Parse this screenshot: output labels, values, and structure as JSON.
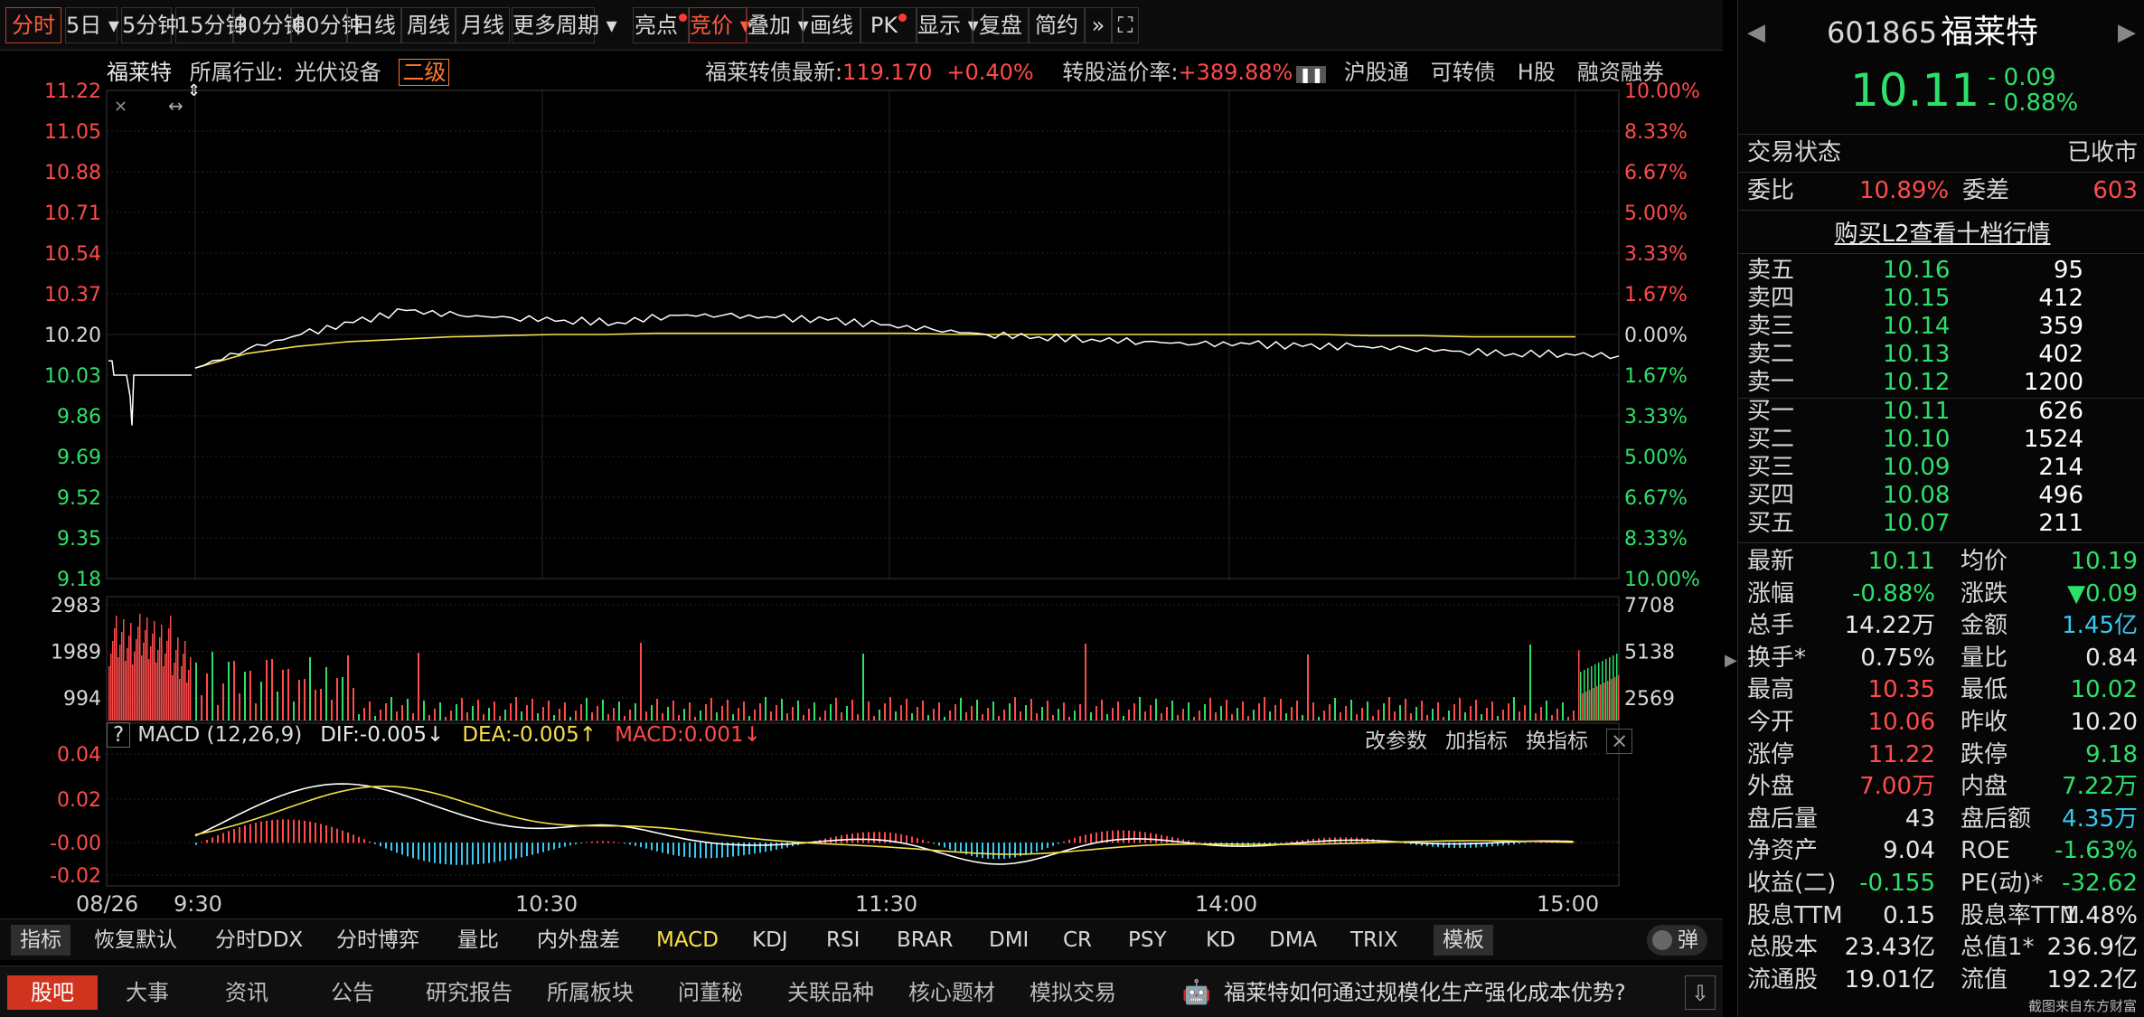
{
  "toolbar": {
    "items": [
      {
        "label": "分时"
      },
      {
        "label": "5日"
      },
      {
        "label": "5分钟"
      },
      {
        "label": "15分钟"
      },
      {
        "label": "30分钟"
      },
      {
        "label": "60分钟"
      },
      {
        "label": "日线"
      },
      {
        "label": "周线"
      },
      {
        "label": "月线"
      },
      {
        "label": "更多周期"
      },
      {
        "label": "亮点"
      },
      {
        "label": "竞价"
      },
      {
        "label": "叠加"
      },
      {
        "label": "画线"
      },
      {
        "label": "PK"
      },
      {
        "label": "显示"
      },
      {
        "label": "复盘"
      },
      {
        "label": "简约"
      }
    ]
  },
  "info": {
    "name": "福莱特",
    "industry_label": "所属行业:",
    "industry": "光伏设备",
    "level": "二级",
    "bond_label": "福莱转债最新:",
    "bond_price": "119.170",
    "bond_change": "+0.40%",
    "premium_label": "转股溢价率:",
    "premium": "+389.88%",
    "links": [
      "沪股通",
      "可转债",
      "H股",
      "融资融券"
    ]
  },
  "price_axis": {
    "left": [
      "11.22",
      "11.05",
      "10.88",
      "10.71",
      "10.54",
      "10.37",
      "10.20",
      "10.03",
      "9.86",
      "9.69",
      "9.52",
      "9.35",
      "9.18"
    ],
    "right": [
      "10.00%",
      "8.33%",
      "6.67%",
      "5.00%",
      "3.33%",
      "1.67%",
      "0.00%",
      "1.67%",
      "3.33%",
      "5.00%",
      "6.67%",
      "8.33%",
      "10.00%"
    ]
  },
  "volume_axis": {
    "left": [
      "2983",
      "1989",
      "994"
    ],
    "right": [
      "7708",
      "5138",
      "2569"
    ]
  },
  "macd": {
    "help": "?",
    "name": "MACD (12,26,9)",
    "dif": "DIF:-0.005↓",
    "dea": "DEA:-0.005↑",
    "macd": "MACD:0.001↓",
    "actions": [
      "改参数",
      "加指标",
      "换指标"
    ],
    "close": "×",
    "axis": [
      "0.04",
      "0.02",
      "-0.00",
      "-0.02"
    ]
  },
  "time_axis": [
    "08/26",
    "9:30",
    "10:30",
    "11:30",
    "14:00",
    "15:00"
  ],
  "indicators": {
    "items": [
      {
        "label": "指标"
      },
      {
        "label": "恢复默认"
      },
      {
        "label": "分时DDX"
      },
      {
        "label": "分时博弈"
      },
      {
        "label": "量比"
      },
      {
        "label": "内外盘差"
      },
      {
        "label": "MACD"
      },
      {
        "label": "KDJ"
      },
      {
        "label": "RSI"
      },
      {
        "label": "BRAR"
      },
      {
        "label": "DMI"
      },
      {
        "label": "CR"
      },
      {
        "label": "PSY"
      },
      {
        "label": "KD"
      },
      {
        "label": "DMA"
      },
      {
        "label": "TRIX"
      },
      {
        "label": "模板"
      }
    ],
    "toggle": "弹"
  },
  "bottom": {
    "items": [
      {
        "label": "股吧"
      },
      {
        "label": "大事"
      },
      {
        "label": "资讯"
      },
      {
        "label": "公告"
      },
      {
        "label": "研究报告"
      },
      {
        "label": "所属板块"
      },
      {
        "label": "问董秘"
      },
      {
        "label": "关联品种"
      },
      {
        "label": "核心题材"
      },
      {
        "label": "模拟交易"
      }
    ],
    "question": "福莱特如何通过规模化生产强化成本优势?"
  },
  "side": {
    "code": "601865",
    "name": "福莱特",
    "price": "10.11",
    "change": "- 0.09",
    "pct": "- 0.88%",
    "status_label": "交易状态",
    "status": "已收市",
    "wb_label": "委比",
    "wb": "10.89%",
    "wc_label": "委差",
    "wc": "603",
    "l2": "购买L2查看十档行情",
    "asks": [
      {
        "l": "卖五",
        "p": "10.16",
        "v": "95"
      },
      {
        "l": "卖四",
        "p": "10.15",
        "v": "412"
      },
      {
        "l": "卖三",
        "p": "10.14",
        "v": "359"
      },
      {
        "l": "卖二",
        "p": "10.13",
        "v": "402"
      },
      {
        "l": "卖一",
        "p": "10.12",
        "v": "1200"
      }
    ],
    "bids": [
      {
        "l": "买一",
        "p": "10.11",
        "v": "626"
      },
      {
        "l": "买二",
        "p": "10.10",
        "v": "1524"
      },
      {
        "l": "买三",
        "p": "10.09",
        "v": "214"
      },
      {
        "l": "买四",
        "p": "10.08",
        "v": "496"
      },
      {
        "l": "买五",
        "p": "10.07",
        "v": "211"
      }
    ],
    "stats": [
      {
        "l1": "最新",
        "v1": "10.11",
        "l2": "均价",
        "v2": "10.19"
      },
      {
        "l1": "涨幅",
        "v1": "-0.88%",
        "l2": "涨跌",
        "v2": "▼0.09"
      },
      {
        "l1": "总手",
        "v1": "14.22万",
        "l2": "金额",
        "v2": "1.45亿"
      },
      {
        "l1": "换手*",
        "v1": "0.75%",
        "l2": "量比",
        "v2": "0.84"
      },
      {
        "l1": "最高",
        "v1": "10.35",
        "l2": "最低",
        "v2": "10.02"
      },
      {
        "l1": "今开",
        "v1": "10.06",
        "l2": "昨收",
        "v2": "10.20"
      },
      {
        "l1": "涨停",
        "v1": "11.22",
        "l2": "跌停",
        "v2": "9.18"
      },
      {
        "l1": "外盘",
        "v1": "7.00万",
        "l2": "内盘",
        "v2": "7.22万"
      },
      {
        "l1": "盘后量",
        "v1": "43",
        "l2": "盘后额",
        "v2": "4.35万"
      },
      {
        "l1": "净资产",
        "v1": "9.04",
        "l2": "ROE",
        "v2": "-1.63%"
      },
      {
        "l1": "收益(二)",
        "v1": "-0.155",
        "l2": "PE(动)*",
        "v2": "-32.62"
      },
      {
        "l1": "股息TTM",
        "v1": "0.15",
        "l2": "股息率TTM",
        "v2": "1.48%"
      },
      {
        "l1": "总股本",
        "v1": "23.43亿",
        "l2": "总值1*",
        "v2": "236.9亿"
      },
      {
        "l1": "流通股",
        "v1": "19.01亿",
        "l2": "流值",
        "v2": "192.2亿"
      }
    ],
    "source": "截图来自东方财富"
  },
  "colors": {
    "up": "#ff4b4b",
    "down": "#2ee06a",
    "price_line": "#ffffff",
    "avg_line": "#f5e04a",
    "dea_line": "#f5e04a",
    "dif_line": "#ffffff"
  },
  "chart_data": {
    "type": "line",
    "series": [
      {
        "values": [
          10.06,
          10.14,
          10.2,
          10.25,
          10.3,
          10.28,
          10.27,
          10.26,
          10.25,
          10.28,
          10.28,
          10.27,
          10.26,
          10.24,
          10.22,
          10.2,
          10.19,
          10.18,
          10.17,
          10.16,
          10.16,
          10.15,
          10.15,
          10.14,
          10.13,
          10.12,
          10.12,
          10.11
        ]
      },
      {
        "values": [
          10.06,
          10.12,
          10.15,
          10.17,
          10.18,
          10.19,
          10.195,
          10.2,
          10.2,
          10.205,
          10.205,
          10.205,
          10.205,
          10.205,
          10.205,
          10.2,
          10.2,
          10.2,
          10.2,
          10.2,
          10.2,
          10.2,
          10.2,
          10.195,
          10.195,
          10.19,
          10.19,
          10.19
        ]
      }
    ],
    "ylim": [
      9.18,
      11.22
    ]
  }
}
